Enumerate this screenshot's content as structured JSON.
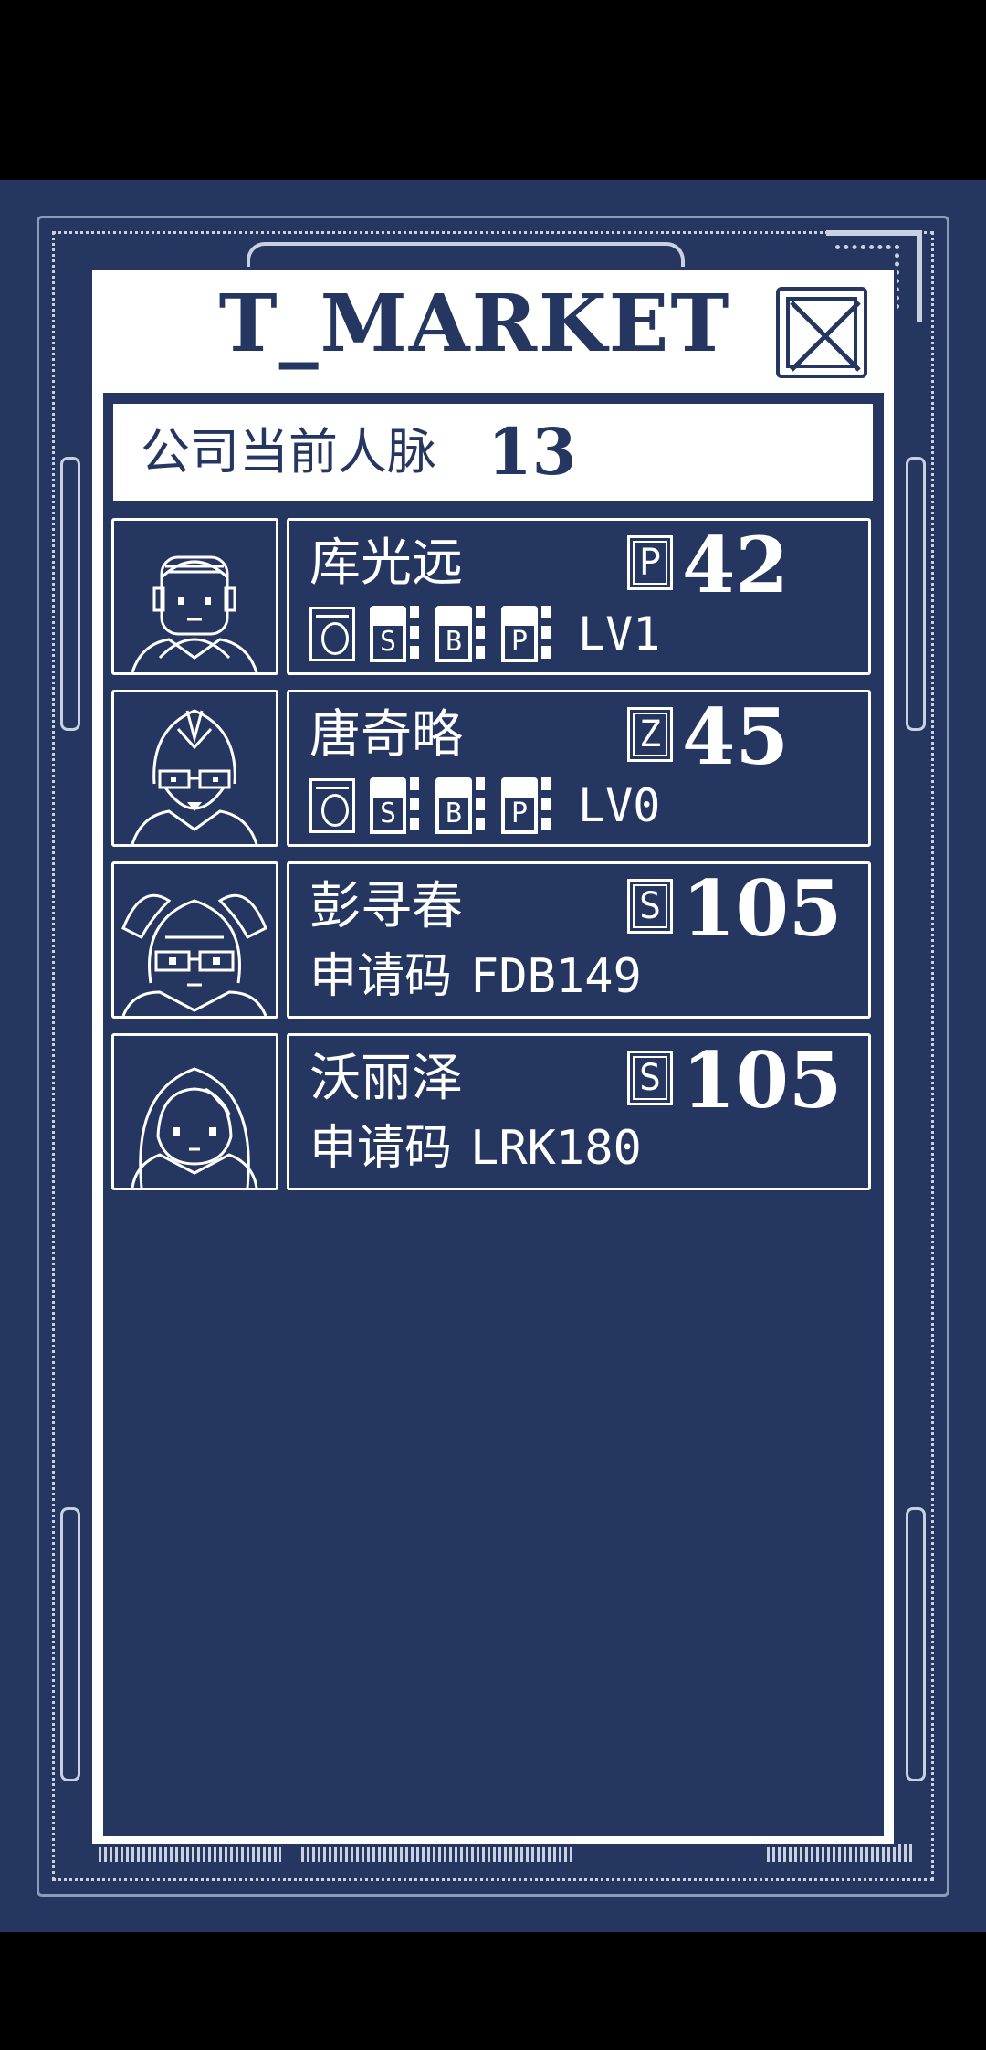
{
  "window": {
    "title": "T_MARKET"
  },
  "network": {
    "label": "公司当前人脉",
    "value": "13"
  },
  "contacts": [
    {
      "name": "库光远",
      "grade": "P",
      "score": "42",
      "stats": [
        "S",
        "B",
        "P"
      ],
      "level": "LV1"
    },
    {
      "name": "唐奇略",
      "grade": "Z",
      "score": "45",
      "stats": [
        "S",
        "B",
        "P"
      ],
      "level": "LV0"
    },
    {
      "name": "彭寻春",
      "grade": "S",
      "score": "105",
      "apply_label": "申请码",
      "apply_code": "FDB149"
    },
    {
      "name": "沃丽泽",
      "grade": "S",
      "score": "105",
      "apply_label": "申请码",
      "apply_code": "LRK180"
    }
  ],
  "colors": {
    "background": "#253760",
    "foreground": "#ffffff",
    "letterbox": "#000000"
  }
}
